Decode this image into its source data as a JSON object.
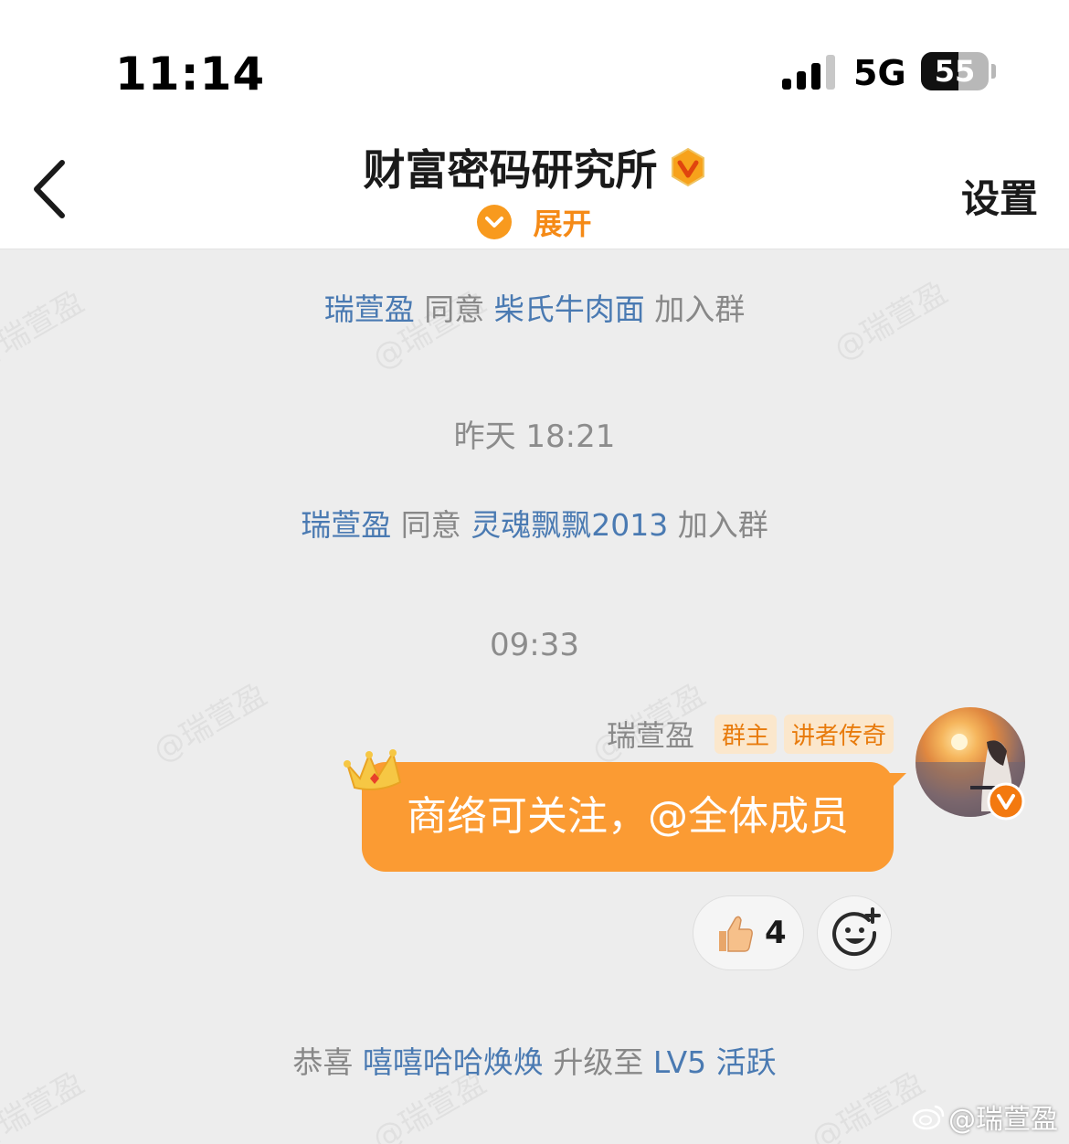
{
  "status_bar": {
    "time": "11:14",
    "network": "5G",
    "battery_level": "55",
    "battery_fraction": 0.55
  },
  "nav": {
    "title": "财富密码研究所",
    "expand_label": "展开",
    "settings_label": "设置"
  },
  "system_messages": [
    {
      "actor": "瑞萱盈",
      "verb": "同意",
      "target": "柴氏牛肉面",
      "suffix": "加入群"
    },
    {
      "actor": "瑞萱盈",
      "verb": "同意",
      "target": "灵魂飘飘2013",
      "suffix": "加入群"
    }
  ],
  "time_separators": [
    "昨天 18:21",
    "09:33"
  ],
  "message": {
    "sender": "瑞萱盈",
    "tags": [
      "群主",
      "讲者传奇"
    ],
    "text": "商络可关注，@全体成员",
    "reaction_count": "4"
  },
  "level_notice": {
    "prefix": "恭喜",
    "user": "嘻嘻哈哈焕焕",
    "middle": "升级至",
    "level": "LV5 活跃"
  },
  "watermark": "@瑞萱盈",
  "weibo_credit": "@瑞萱盈",
  "colors": {
    "accent_orange": "#fb9b33",
    "link_blue": "#4a7ab2",
    "tag_text": "#e87b0c",
    "tag_bg": "#fbe7cc"
  }
}
